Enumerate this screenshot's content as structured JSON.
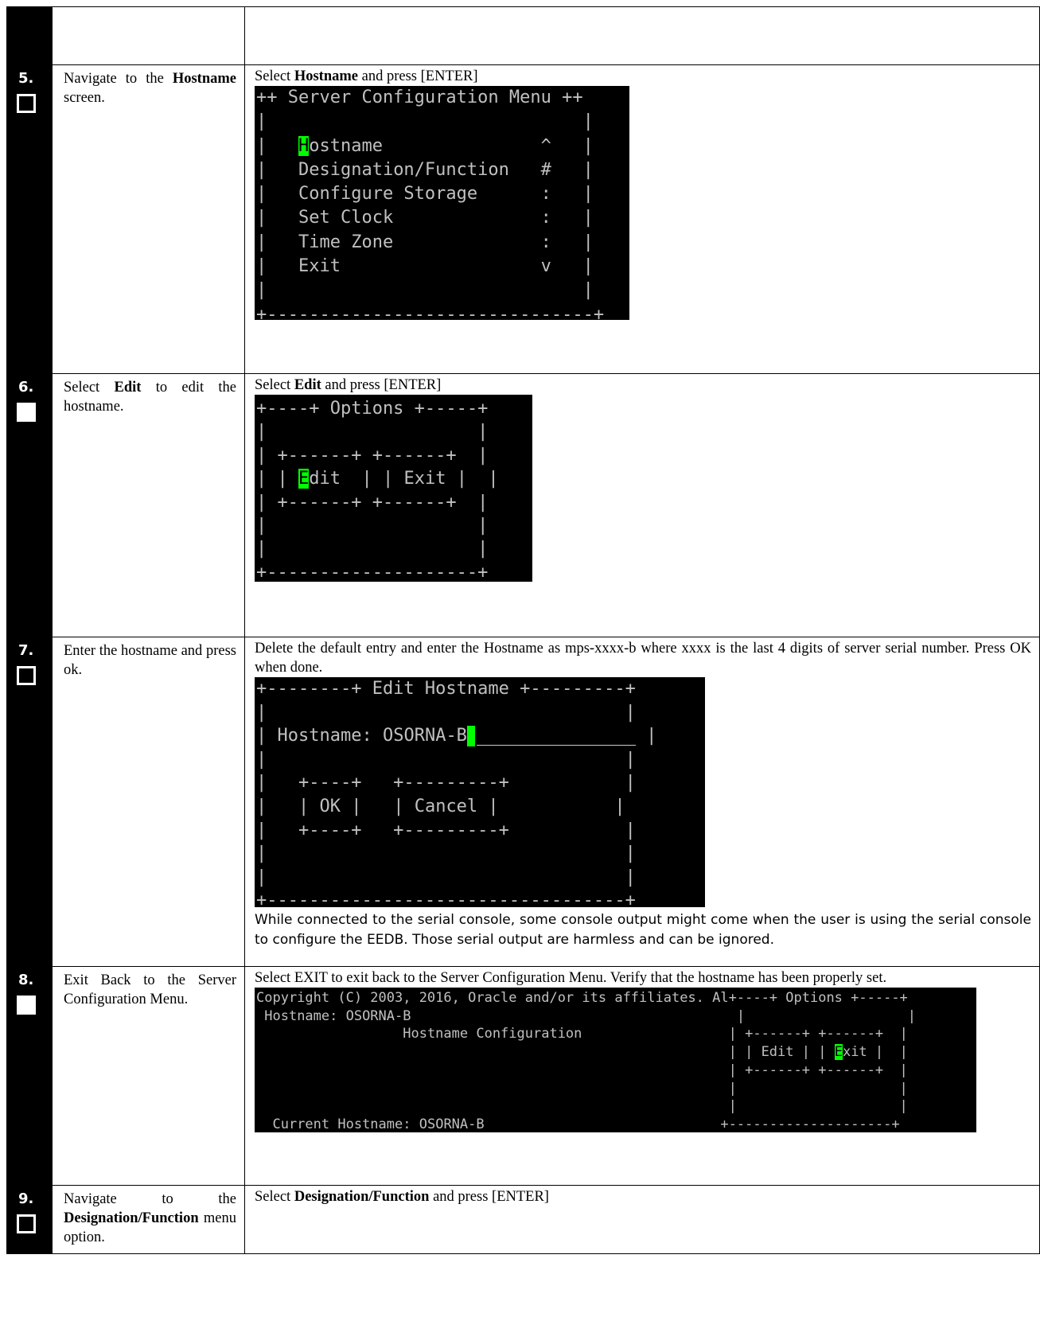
{
  "rows": [
    {
      "num": "",
      "instruction": "",
      "action": ""
    },
    {
      "num": "5.",
      "instruction_pre": "Navigate to the ",
      "instruction_bold": "Hostname",
      "instruction_post": " screen.",
      "action_pre": "Select ",
      "action_bold": "Hostname",
      "action_post": " and press [ENTER]",
      "terminal": {
        "title_line": "++ Server Configuration Menu ++",
        "cursor_char": "H",
        "menu": [
          {
            "label": "ostname",
            "mark": "^"
          },
          {
            "label": "Designation/Function",
            "mark": "#"
          },
          {
            "label": "Configure Storage",
            "mark": ":"
          },
          {
            "label": "Set Clock",
            "mark": ":"
          },
          {
            "label": "Time Zone",
            "mark": ":"
          },
          {
            "label": "Exit",
            "mark": "v"
          }
        ],
        "bottom_line": "+-------------------------------+"
      }
    },
    {
      "num": "6.",
      "instruction_pre": "Select ",
      "instruction_bold": "Edit",
      "instruction_post": " to edit the hostname.",
      "action_pre": "Select ",
      "action_bold": "Edit",
      "action_post": " and press [ENTER]",
      "terminal": {
        "title_line": "+----+ Options +-----+",
        "btn_top": "| +------+ +------+  |",
        "cursor_char": "E",
        "edit_rest": "dit",
        "exit_label": "Exit",
        "bottom_line": "+--------------------+"
      }
    },
    {
      "num": "7.",
      "instruction": "Enter the hostname and press ok.",
      "action": "Delete the default entry and enter the Hostname as mps-xxxx-b where xxxx is the last 4 digits of server serial number. Press OK when done.",
      "terminal": {
        "title_line": "+--------+ Edit Hostname +---------+",
        "field_label": "Hostname:",
        "field_value": "OSORNA-B",
        "ok_label": "OK",
        "cancel_label": "Cancel",
        "bottom_line": "+----------------------------------+"
      },
      "note": "While connected to the serial console, some console output might come when the user is using the serial console to configure the EEDB. Those serial output are harmless and can be ignored."
    },
    {
      "num": "8.",
      "instruction": "Exit Back to the Server Configuration Menu.",
      "action": "Select EXIT to exit back to the Server Configuration Menu. Verify that the hostname has been properly set.",
      "terminal": {
        "copyright": "Copyright (C) 2003, 2016, Oracle and/or its affiliates. Al",
        "options_title": "+----+ Options +-----+",
        "hostname_line": "Hostname: OSORNA-B",
        "config_title": "Hostname Configuration",
        "edit_label": "Edit",
        "cursor_char": "E",
        "exit_rest": "xit",
        "current_label": "Current Hostname:",
        "current_value": "OSORNA-B"
      }
    },
    {
      "num": "9.",
      "instruction_pre": "Navigate to the ",
      "instruction_bold": "Designation/Function",
      "instruction_post": " menu option.",
      "action_pre": "Select ",
      "action_bold": "Designation/Function",
      "action_post": " and press [ENTER]"
    }
  ]
}
